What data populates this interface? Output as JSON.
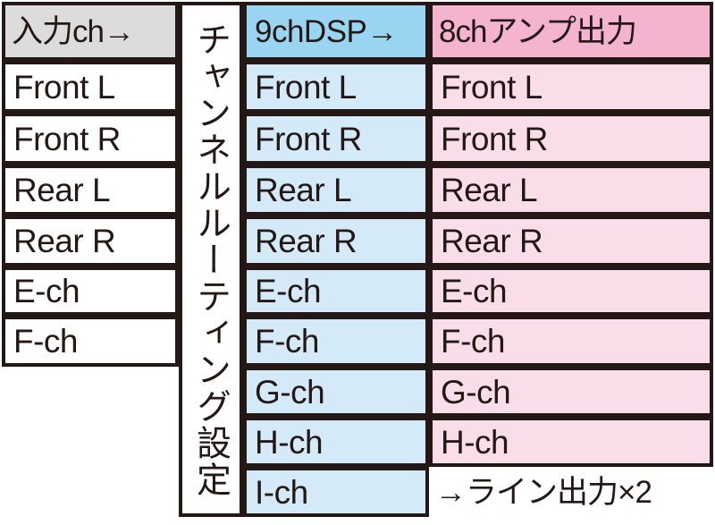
{
  "diagram": {
    "title_vertical": "チャンネルルーティング設定",
    "columns": {
      "input": {
        "header": "入力ch→",
        "rows": [
          "Front L",
          "Front R",
          "Rear L",
          "Rear R",
          "E-ch",
          "F-ch"
        ]
      },
      "dsp": {
        "header": "9chDSP→",
        "rows": [
          "Front L",
          "Front R",
          "Rear L",
          "Rear R",
          "E-ch",
          "F-ch",
          "G-ch",
          "H-ch",
          "I-ch"
        ]
      },
      "amp": {
        "header": "8chアンプ出力",
        "rows": [
          "Front L",
          "Front R",
          "Rear L",
          "Rear R",
          "E-ch",
          "F-ch",
          "G-ch",
          "H-ch",
          "→ライン出力×2"
        ]
      }
    },
    "colors": {
      "ink": "#231815",
      "input_header_fill": "#dcdcdc",
      "input_body_fill": "#ffffff",
      "dsp_header_fill": "#99d4f0",
      "dsp_body_fill": "#d4eaf8",
      "amp_header_fill": "#f4b3cf",
      "amp_body_fill": "#f9dee9",
      "note_fill": "#ffffff"
    }
  }
}
